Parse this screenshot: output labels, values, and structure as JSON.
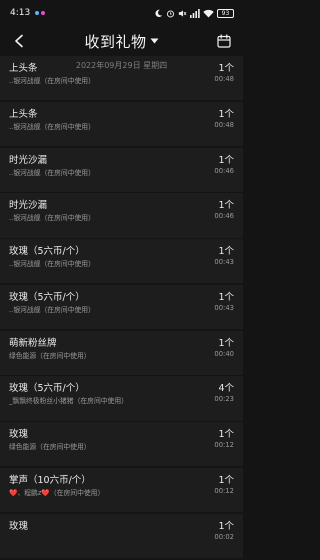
{
  "status": {
    "time": "4:13",
    "dot_colors": [
      "#5ab4ff",
      "#e94cc8"
    ],
    "battery": "93"
  },
  "nav": {
    "title": "收到礼物",
    "date_hint": "2022年09月29日 星期四"
  },
  "gifts": [
    {
      "name": "上头条",
      "sub": "..银河战舰（在房间中使用）",
      "count": "1个",
      "time": "00:48"
    },
    {
      "name": "上头条",
      "sub": "..银河战舰（在房间中使用）",
      "count": "1个",
      "time": "00:48"
    },
    {
      "name": "时光沙漏",
      "sub": "..银河战舰（在房间中使用）",
      "count": "1个",
      "time": "00:46"
    },
    {
      "name": "时光沙漏",
      "sub": "..银河战舰（在房间中使用）",
      "count": "1个",
      "time": "00:46"
    },
    {
      "name": "玫瑰（5六币/个）",
      "sub": "..银河战舰（在房间中使用）",
      "count": "1个",
      "time": "00:43"
    },
    {
      "name": "玫瑰（5六币/个）",
      "sub": "..银河战舰（在房间中使用）",
      "count": "1个",
      "time": "00:43"
    },
    {
      "name": "萌新粉丝牌",
      "sub": "绿色能源（在房间中使用）",
      "count": "1个",
      "time": "00:40"
    },
    {
      "name": "玫瑰（5六币/个）",
      "sub": "_飘飘终极粉丝小猪猪（在房间中使用）",
      "count": "4个",
      "time": "00:23"
    },
    {
      "name": "玫瑰",
      "sub": "绿色能源（在房间中使用）",
      "count": "1个",
      "time": "00:12"
    },
    {
      "name": "掌声（10六币/个）",
      "sub_prefix": "❤️、程鹏z",
      "sub_heart": "❤️",
      "sub_suffix": "（在房间中使用）",
      "count": "1个",
      "time": "00:12"
    },
    {
      "name": "玫瑰",
      "sub": "",
      "count": "1个",
      "time": "00:02"
    }
  ]
}
